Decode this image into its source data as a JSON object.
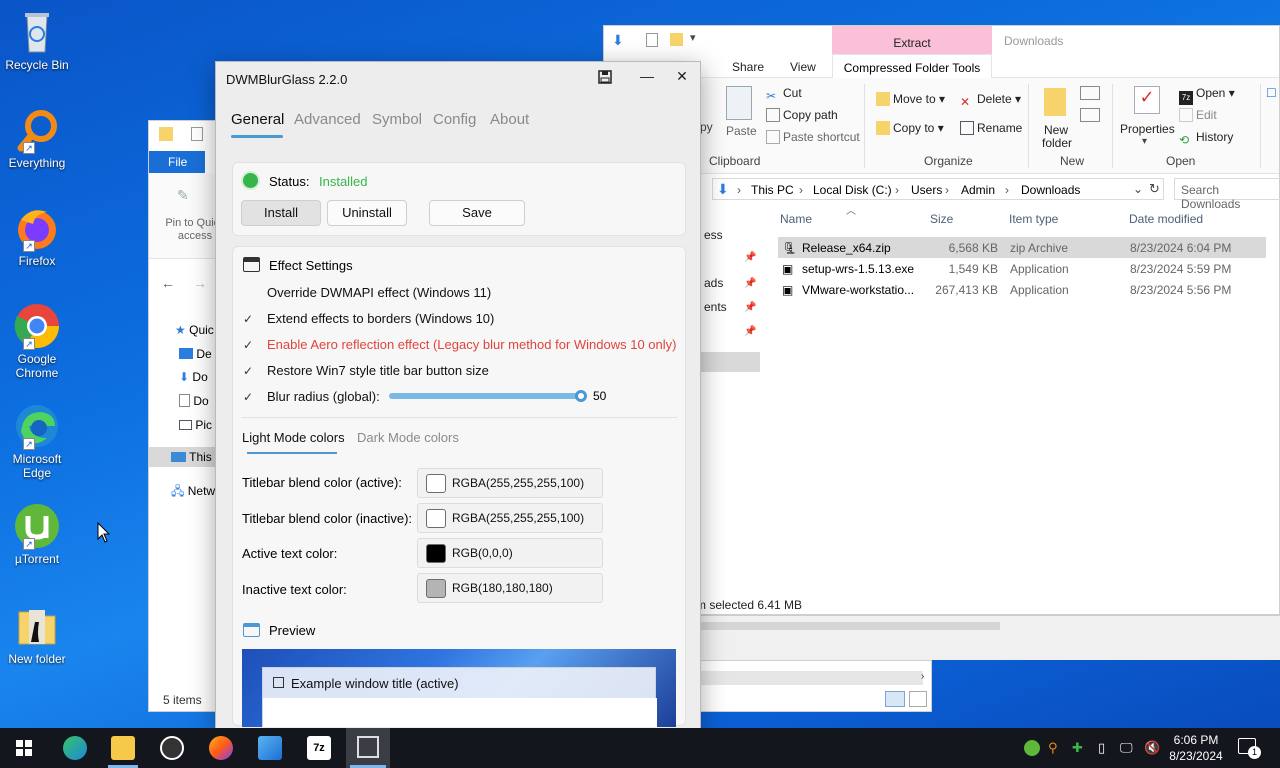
{
  "desktop": {
    "icons": [
      {
        "label": "Recycle Bin",
        "icon": "recycle-bin-icon"
      },
      {
        "label": "Everything",
        "icon": "everything-search-icon"
      },
      {
        "label": "Firefox",
        "icon": "firefox-icon"
      },
      {
        "label": "Google Chrome",
        "icon": "chrome-icon"
      },
      {
        "label": "Microsoft Edge",
        "icon": "edge-icon"
      },
      {
        "label": "µTorrent",
        "icon": "utorrent-icon"
      },
      {
        "label": "New folder",
        "icon": "folder-icon"
      }
    ]
  },
  "explorer": {
    "context_tab_group": "Extract",
    "title_hint": "Downloads",
    "tabs": [
      "Share",
      "View",
      "Compressed Folder Tools"
    ],
    "clipboard": {
      "paste": "Paste",
      "cut": "Cut",
      "copy_path": "Copy path",
      "paste_shortcut": "Paste shortcut",
      "group": "Clipboard",
      "partial": "py"
    },
    "organize": {
      "move_to": "Move to",
      "copy_to": "Copy to",
      "delete": "Delete",
      "rename": "Rename",
      "group": "Organize"
    },
    "new": {
      "new_folder": "New folder",
      "group": "New"
    },
    "open": {
      "properties": "Properties",
      "open": "Open",
      "edit": "Edit",
      "history": "History",
      "group": "Open"
    },
    "address": [
      "This PC",
      "Local Disk (C:)",
      "Users",
      "Admin",
      "Downloads"
    ],
    "search_placeholder": "Search Downloads",
    "columns": {
      "name": "Name",
      "size": "Size",
      "type": "Item type",
      "date": "Date modified"
    },
    "files": [
      {
        "name": "Release_x64.zip",
        "size": "6,568 KB",
        "type": "zip Archive",
        "date": "8/23/2024 6:04 PM"
      },
      {
        "name": "setup-wrs-1.5.13.exe",
        "size": "1,549 KB",
        "type": "Application",
        "date": "8/23/2024 5:59 PM"
      },
      {
        "name": "VMware-workstatio...",
        "size": "267,413 KB",
        "type": "Application",
        "date": "8/23/2024 5:56 PM"
      }
    ],
    "side_partials": [
      "ess",
      "ads",
      "ents"
    ],
    "status": "m selected  6.41 MB"
  },
  "explorer2": {
    "file_tab": "File",
    "pin": "Pin to Quick access",
    "tree": [
      "Quic",
      "De",
      "Do",
      "Do",
      "Pic",
      "This",
      "Netw"
    ],
    "items_count": "5 items"
  },
  "dwm": {
    "title": "DWMBlurGlass 2.2.0",
    "nav": [
      "General",
      "Advanced",
      "Symbol",
      "Config",
      "About"
    ],
    "status_label": "Status:",
    "status_value": "Installed",
    "buttons": {
      "install": "Install",
      "uninstall": "Uninstall",
      "save": "Save"
    },
    "effect_header": "Effect Settings",
    "options": [
      {
        "label": "Override DWMAPI effect (Windows 11)",
        "checked": false
      },
      {
        "label": "Extend effects to borders (Windows 10)",
        "checked": true
      },
      {
        "label": "Enable Aero reflection effect (Legacy blur method for Windows 10 only)",
        "checked": true
      },
      {
        "label": "Restore Win7 style title bar button size",
        "checked": true
      }
    ],
    "blur_label": "Blur radius (global):",
    "blur_value": "50",
    "blur_fraction": 0.98,
    "color_tabs": [
      "Light Mode colors",
      "Dark Mode colors"
    ],
    "colors": [
      {
        "label": "Titlebar blend color (active):",
        "value": "RGBA(255,255,255,100)",
        "swatch": "#ffffff"
      },
      {
        "label": "Titlebar blend color (inactive):",
        "value": "RGBA(255,255,255,100)",
        "swatch": "#ffffff"
      },
      {
        "label": "Active text color:",
        "value": "RGB(0,0,0)",
        "swatch": "#000000"
      },
      {
        "label": "Inactive text color:",
        "value": "RGB(180,180,180)",
        "swatch": "#b4b4b4"
      }
    ],
    "preview_header": "Preview",
    "preview_window_title": "Example window title (active)",
    "accent": "#4a98d4",
    "warn": "#e0443c",
    "ok": "#35b54a"
  },
  "taskbar": {
    "time": "6:06 PM",
    "date": "8/23/2024",
    "notification_count": "1"
  }
}
